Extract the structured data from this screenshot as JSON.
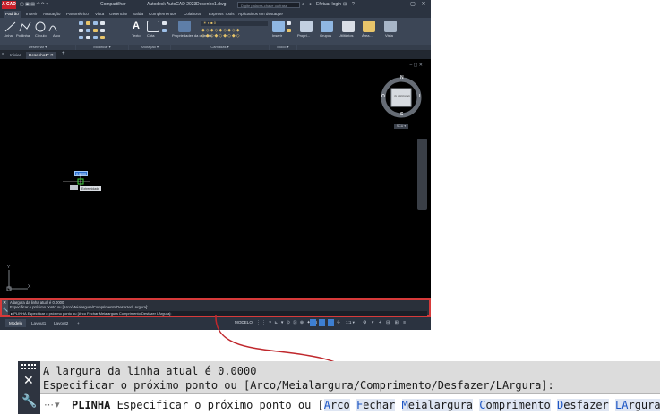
{
  "titlebar": {
    "logo": "A CAD",
    "share": "Compartilhar",
    "app_title": "Autodesk AutoCAD 2023",
    "file_name": "Desenho1.dwg",
    "search_placeholder": "Digite palavra-chave ou frase",
    "login": "Efetuar login"
  },
  "ribbon_tabs": [
    "Padrão",
    "Inserir",
    "Anotação",
    "Paramétrico",
    "Vista",
    "Gerenciar",
    "Saída",
    "Complementos",
    "Colaborar",
    "Express Tools",
    "Aplicativos em destaque"
  ],
  "ribbon": {
    "draw_tools": [
      "Linha",
      "Polilinha",
      "Círculo",
      "Arco"
    ],
    "text": "Texto",
    "dimension": "Cota",
    "properties": "Propriedades da camada",
    "insert": "Inserir",
    "properties2": "Propri...",
    "groups": "Grupos",
    "utilities": "Utilitários",
    "clipboard": "Área...",
    "view": "Vista",
    "layer_value": "0",
    "panels": [
      "Desenhar",
      "Modificar",
      "Anotação",
      "Camadas",
      "Bloco"
    ]
  },
  "doc_tabs": [
    "Iniciar",
    "Desenho1*"
  ],
  "viewcube": {
    "north": "N",
    "south": "S",
    "east": "L",
    "west": "O",
    "face": "SUPERIOR",
    "wcs": "SCU"
  },
  "cursor": {
    "input_value": "0.0000",
    "tooltip": "Extremidade"
  },
  "ucs": {
    "y": "Y",
    "x": "X"
  },
  "acad_cmd": {
    "line1": "A largura da linha atual é 0.0000",
    "line2": "Especificar o próximo ponto ou [Arco/Meialargura/Comprimento/Desfazer/LArgura]:",
    "input": "PLINHA Especificar o próximo ponto ou [Arco Fechar Meialargura Comprimento Desfazer LArgura]:"
  },
  "layout_tabs": [
    "Modelo",
    "Layout1",
    "Layout2",
    "+"
  ],
  "status": {
    "model": "MODELO",
    "scale": "1:1"
  },
  "zoom_cmd": {
    "line1": "A largura da linha atual é 0.0000",
    "line2": "Especificar o próximo ponto ou [Arco/Meialargura/Comprimento/Desfazer/LArgura]:",
    "command": "PLINHA",
    "prompt": "Especificar o próximo ponto ou [",
    "options": [
      {
        "key": "A",
        "rest": "rco"
      },
      {
        "key": "F",
        "rest": "echar"
      },
      {
        "key": "M",
        "rest": "eialargura"
      },
      {
        "key": "C",
        "rest": "omprimento"
      },
      {
        "key": "D",
        "rest": "esfazer"
      },
      {
        "key": "LA",
        "rest": "rgura"
      }
    ],
    "end": "]:"
  },
  "colors": {
    "highlight": "#d73a3a",
    "option_key": "#1d56c4"
  }
}
